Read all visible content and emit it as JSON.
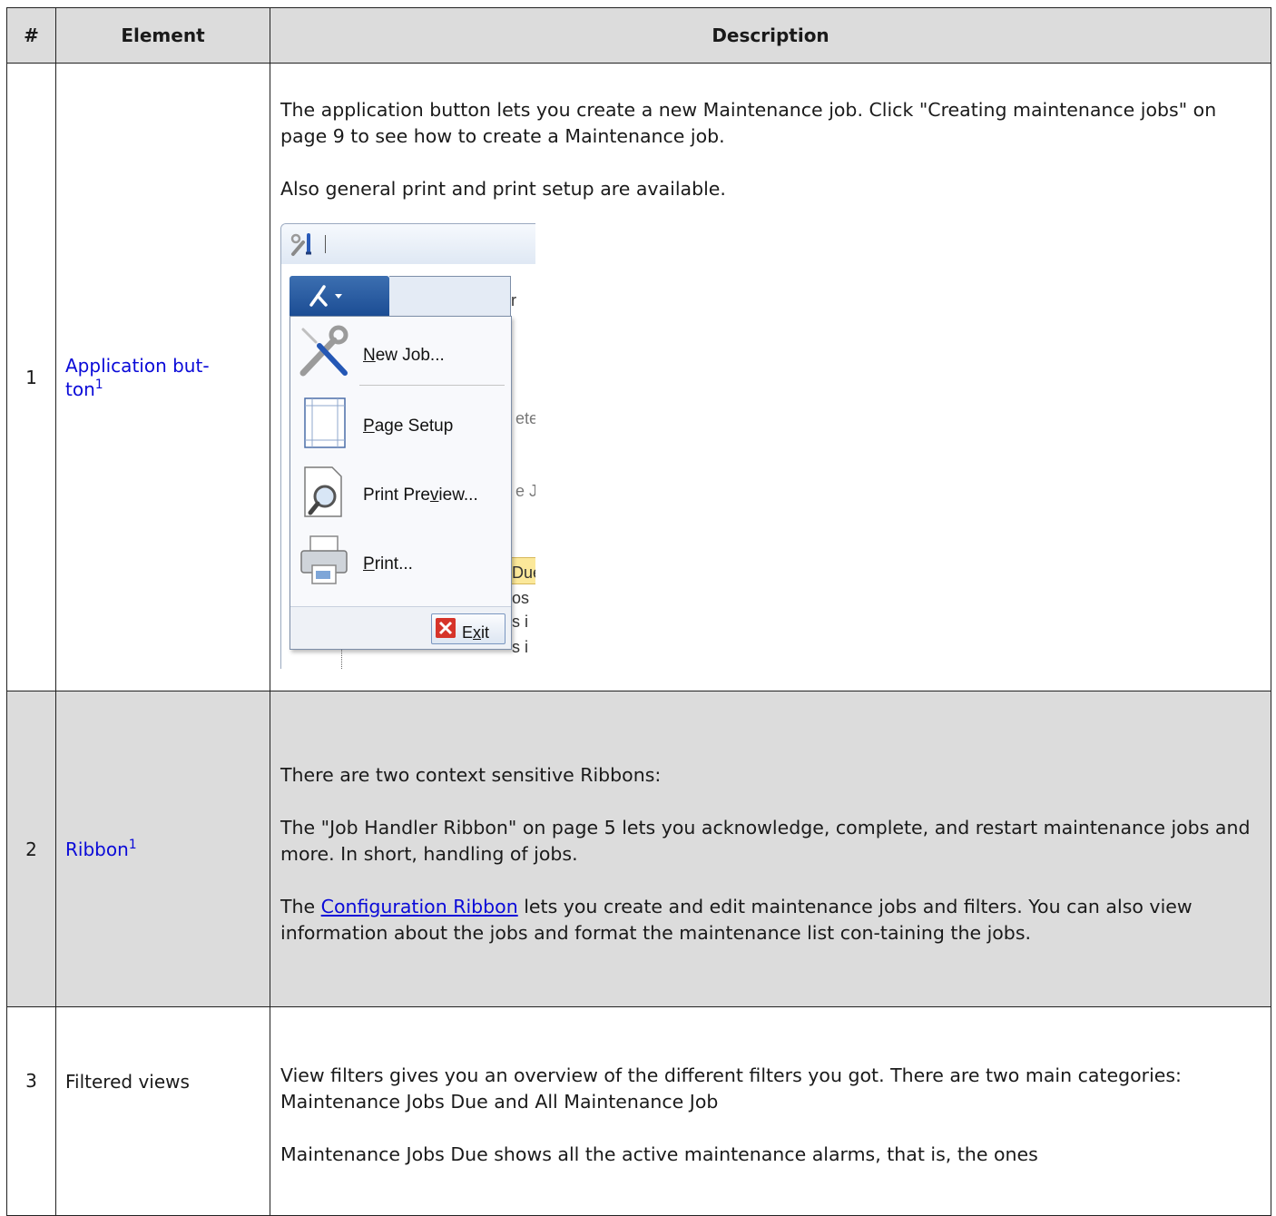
{
  "table": {
    "headers": {
      "num": "#",
      "element": "Element",
      "description": "Description"
    },
    "rows": [
      {
        "num": "1",
        "element": "Application but-ton",
        "element_line1": "Application but-",
        "element_line2": "ton",
        "element_sup": "1",
        "paragraphs": [
          "The application button lets you create a new Maintenance job. Click \"Creating maintenance jobs\" on page 9 to see how to create a Maintenance job.",
          "Also general print and print setup are available."
        ]
      },
      {
        "num": "2",
        "element": "Ribbon",
        "element_sup": "1",
        "paragraphs": [
          "There are two context sensitive Ribbons:",
          "The \"Job Handler Ribbon\" on page 5 lets you acknowledge, complete, and restart maintenance jobs and more. In short, handling of jobs."
        ],
        "p3_before": "The ",
        "p3_link": "Configuration Ribbon",
        "p3_after": " lets you create and edit maintenance jobs and filters. You can also view information about the jobs and format the maintenance list con-taining the jobs."
      },
      {
        "num": "3",
        "element": "Filtered views",
        "paragraphs": [
          "View filters gives you an overview of the different filters you got. There are two main categories: Maintenance Jobs Due and All Maintenance Job",
          "Maintenance Jobs Due shows all the active maintenance alarms, that is, the ones"
        ]
      }
    ]
  },
  "screenshot": {
    "menu_items": [
      {
        "label_pre": "",
        "label_u": "N",
        "label_post": "ew Job...",
        "icon": "wrench-screwdriver-icon"
      },
      {
        "label_pre": "",
        "label_u": "P",
        "label_post": "age Setup",
        "icon": "page-setup-icon"
      },
      {
        "label_pre": "Print Pre",
        "label_u": "v",
        "label_post": "iew...",
        "icon": "print-preview-icon"
      },
      {
        "label_pre": "",
        "label_u": "P",
        "label_post": "rint...",
        "icon": "printer-icon"
      }
    ],
    "exit": {
      "label_pre": "E",
      "label_u": "x",
      "label_post": "it"
    },
    "background_fragments": [
      "r",
      "ete",
      "e J",
      "Due",
      "os",
      "s i",
      "s i"
    ]
  }
}
